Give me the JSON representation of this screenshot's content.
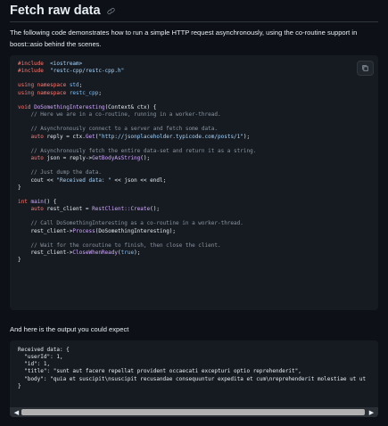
{
  "heading": {
    "title": "Fetch raw data",
    "anchor_icon": "link-icon"
  },
  "intro": "The following code demonstrates how to run a simple HTTP request asynchronously, using the co-routine support in boost::asio behind the scenes.",
  "code1": {
    "copy_icon": "copy-icon",
    "lines": [
      [
        [
          "kw",
          "#include"
        ],
        [
          "",
          "  "
        ],
        [
          "str",
          "<iostream>"
        ]
      ],
      [
        [
          "kw",
          "#include"
        ],
        [
          "",
          "  "
        ],
        [
          "str",
          "\"restc-cpp/restc-cpp.h\""
        ]
      ],
      [],
      [
        [
          "kw",
          "using namespace"
        ],
        [
          "",
          " "
        ],
        [
          "ent",
          "std"
        ],
        [
          "",
          ";"
        ]
      ],
      [
        [
          "kw",
          "using namespace"
        ],
        [
          "",
          " "
        ],
        [
          "ent",
          "restc_cpp"
        ],
        [
          "",
          ";"
        ]
      ],
      [],
      [
        [
          "kw",
          "void"
        ],
        [
          "",
          " "
        ],
        [
          "fn",
          "DoSomethingInteresting"
        ],
        [
          "",
          "(Context& ctx) {"
        ]
      ],
      [
        [
          "",
          "    "
        ],
        [
          "cm",
          "// Here we are in a co-routine, running in a worker-thread."
        ]
      ],
      [],
      [
        [
          "",
          "    "
        ],
        [
          "cm",
          "// Asynchronously connect to a server and fetch some data."
        ]
      ],
      [
        [
          "",
          "    "
        ],
        [
          "kw",
          "auto"
        ],
        [
          "",
          " reply = ctx."
        ],
        [
          "fn",
          "Get"
        ],
        [
          "",
          "("
        ],
        [
          "str",
          "\"http://jsonplaceholder.typicode.com/posts/1\""
        ],
        [
          "",
          ");"
        ]
      ],
      [],
      [
        [
          "",
          "    "
        ],
        [
          "cm",
          "// Asynchronously fetch the entire data-set and return it as a string."
        ]
      ],
      [
        [
          "",
          "    "
        ],
        [
          "kw",
          "auto"
        ],
        [
          "",
          " json = reply->"
        ],
        [
          "fn",
          "GetBodyAsString"
        ],
        [
          "",
          "();"
        ]
      ],
      [],
      [
        [
          "",
          "    "
        ],
        [
          "cm",
          "// Just dump the data."
        ]
      ],
      [
        [
          "",
          "    cout << "
        ],
        [
          "str",
          "\"Received data: \""
        ],
        [
          "",
          " << json << endl;"
        ]
      ],
      [
        [
          "",
          "}"
        ]
      ],
      [],
      [
        [
          "kw",
          "int"
        ],
        [
          "",
          " "
        ],
        [
          "fn",
          "main"
        ],
        [
          "",
          "() {"
        ]
      ],
      [
        [
          "",
          "    "
        ],
        [
          "kw",
          "auto"
        ],
        [
          "",
          " rest_client = "
        ],
        [
          "fn",
          "RestClient::Create"
        ],
        [
          "",
          "();"
        ]
      ],
      [],
      [
        [
          "",
          "    "
        ],
        [
          "cm",
          "// Call DoSomethingInteresting as a co-routine in a worker-thread."
        ]
      ],
      [
        [
          "",
          "    rest_client->"
        ],
        [
          "fn",
          "Process"
        ],
        [
          "",
          "(DoSomethingInteresting);"
        ]
      ],
      [],
      [
        [
          "",
          "    "
        ],
        [
          "cm",
          "// Wait for the coroutine to finish, then close the client."
        ]
      ],
      [
        [
          "",
          "    rest_client->"
        ],
        [
          "fn",
          "CloseWhenReady"
        ],
        [
          "",
          "("
        ],
        [
          "ent",
          "true"
        ],
        [
          "",
          ");"
        ]
      ],
      [
        [
          "",
          "}"
        ]
      ]
    ]
  },
  "output_intro": "And here is the output you could expect",
  "output": {
    "lines": [
      "Received data: {",
      "  \"userId\": 1,",
      "  \"id\": 1,",
      "  \"title\": \"sunt aut facere repellat provident occaecati excepturi optio reprehenderit\",",
      "  \"body\": \"quia et suscipit\\nsuscipit recusandae consequuntur expedita et cum\\nreprehenderit molestiae ut ut",
      "}"
    ],
    "scroll_left": "◀",
    "scroll_right": "▶"
  }
}
